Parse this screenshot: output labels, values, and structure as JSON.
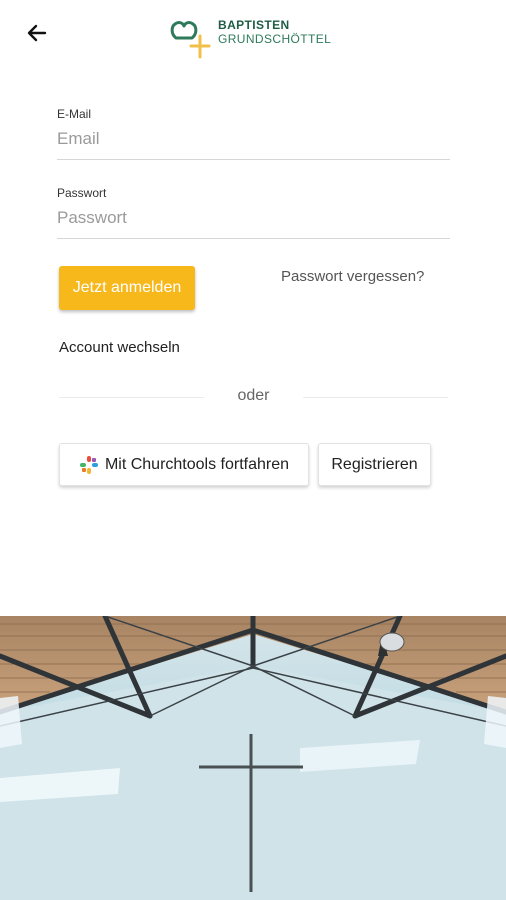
{
  "header": {
    "back_icon": "arrow-left-icon",
    "logo_line1": "BAPTISTEN",
    "logo_line2": "GRUNDSCHÖTTEL"
  },
  "form": {
    "email_label": "E-Mail",
    "email_placeholder": "Email",
    "email_value": "",
    "password_label": "Passwort",
    "password_placeholder": "Passwort",
    "password_value": "",
    "login_button": "Jetzt anmelden",
    "forgot_password": "Passwort vergessen?",
    "switch_account": "Account wechseln",
    "divider_text": "oder",
    "churchtools_button": "Mit Churchtools fortfahren",
    "register_button": "Registrieren"
  },
  "colors": {
    "accent": "#f7b81c",
    "logo_green": "#2e7a5b",
    "logo_yellow": "#f0c04a"
  }
}
